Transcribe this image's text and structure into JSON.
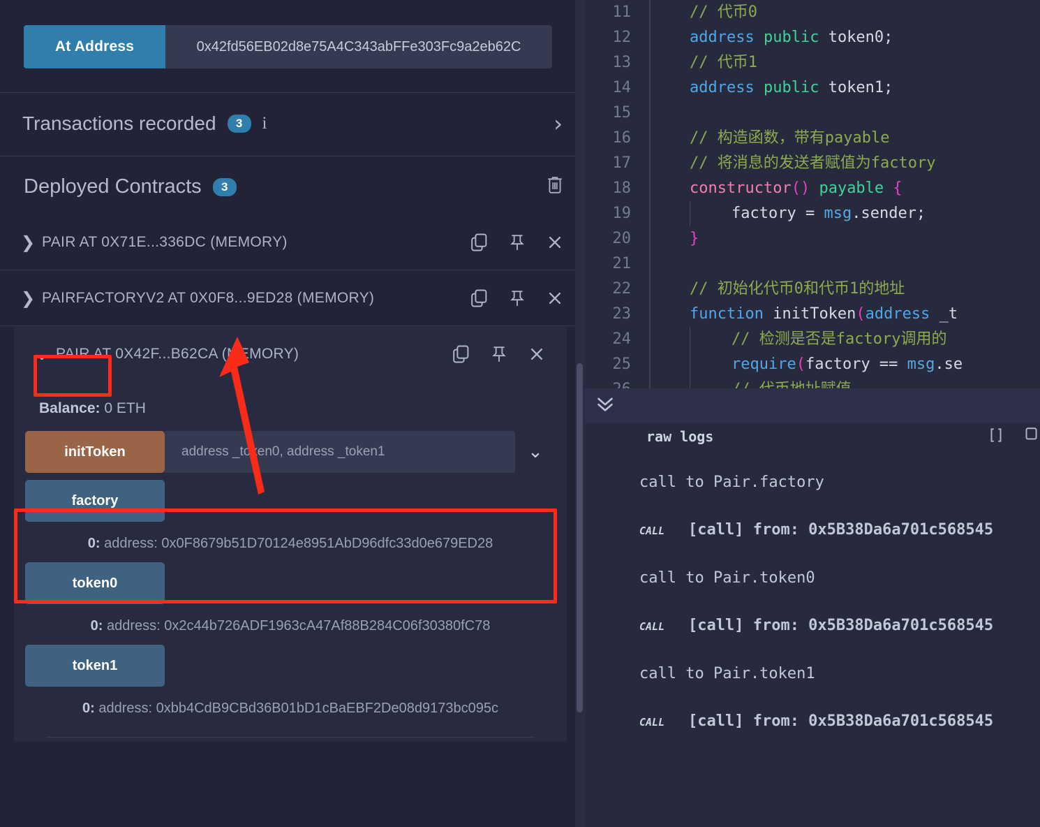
{
  "left_panel": {
    "at_address": {
      "button_label": "At Address",
      "input_value": "0x42fd56EB02d8e75A4C343abFFe303Fc9a2eb62C"
    },
    "transactions": {
      "title": "Transactions recorded",
      "count": "3",
      "info_glyph": "i",
      "chevron": "›"
    },
    "deployed": {
      "title": "Deployed Contracts",
      "count": "3",
      "trash_icon": "trash-icon"
    },
    "contracts": [
      {
        "label": "PAIR AT 0X71E...336DC (MEMORY)",
        "chevron": "❯",
        "expanded": false
      },
      {
        "label": "PAIRFACTORYV2 AT 0X0F8...9ED28 (MEMORY)",
        "chevron": "❯",
        "expanded": false
      },
      {
        "label": "PAIR AT 0X42F...B62CA (MEMORY)",
        "chevron": "⌄",
        "expanded": true
      }
    ],
    "expanded_card": {
      "balance_label": "Balance:",
      "balance_value": "0 ETH",
      "functions": [
        {
          "name": "initToken",
          "kind": "write",
          "input_placeholder": "address _token0, address _token1",
          "caret": "⌄",
          "result_index": "",
          "result_value": ""
        },
        {
          "name": "factory",
          "kind": "read",
          "result_index": "0:",
          "result_value": "address: 0x0F8679b51D70124e8951AbD96dfc33d0e679ED28"
        },
        {
          "name": "token0",
          "kind": "read",
          "result_index": "0:",
          "result_value": "address: 0x2c44b726ADF1963cA47Af88B284C06f30380fC78"
        },
        {
          "name": "token1",
          "kind": "read",
          "result_index": "0:",
          "result_value": "address: 0xbb4CdB9CBd36B01bD1cBaEBF2De08d9173bc095c"
        }
      ]
    }
  },
  "editor": {
    "lines": [
      {
        "n": "11",
        "indent": 1,
        "segments": [
          {
            "t": "// 代币0",
            "c": "tok-com"
          }
        ]
      },
      {
        "n": "12",
        "indent": 1,
        "segments": [
          {
            "t": "address",
            "c": "tok-kw"
          },
          {
            "t": " ",
            "c": "tok-id"
          },
          {
            "t": "public",
            "c": "tok-kw2"
          },
          {
            "t": " token0;",
            "c": "tok-id"
          }
        ]
      },
      {
        "n": "13",
        "indent": 1,
        "segments": [
          {
            "t": "// 代币1",
            "c": "tok-com"
          }
        ]
      },
      {
        "n": "14",
        "indent": 1,
        "segments": [
          {
            "t": "address",
            "c": "tok-kw"
          },
          {
            "t": " ",
            "c": "tok-id"
          },
          {
            "t": "public",
            "c": "tok-kw2"
          },
          {
            "t": " token1;",
            "c": "tok-id"
          }
        ]
      },
      {
        "n": "15",
        "indent": 1,
        "segments": []
      },
      {
        "n": "16",
        "indent": 1,
        "segments": [
          {
            "t": "// 构造函数，带有payable",
            "c": "tok-com"
          }
        ]
      },
      {
        "n": "17",
        "indent": 1,
        "segments": [
          {
            "t": "// 将消息的发送者赋值为factory",
            "c": "tok-com"
          }
        ]
      },
      {
        "n": "18",
        "indent": 1,
        "segments": [
          {
            "t": "constructor",
            "c": "tok-fn"
          },
          {
            "t": "()",
            "c": "tok-mag"
          },
          {
            "t": " ",
            "c": "tok-id"
          },
          {
            "t": "payable",
            "c": "tok-kw2"
          },
          {
            "t": " ",
            "c": "tok-id"
          },
          {
            "t": "{",
            "c": "tok-mag"
          }
        ]
      },
      {
        "n": "19",
        "indent": 2,
        "segments": [
          {
            "t": "factory",
            "c": "tok-id"
          },
          {
            "t": " = ",
            "c": "tok-id"
          },
          {
            "t": "msg",
            "c": "tok-blue2"
          },
          {
            "t": ".sender;",
            "c": "tok-id"
          }
        ]
      },
      {
        "n": "20",
        "indent": 1,
        "segments": [
          {
            "t": "}",
            "c": "tok-mag"
          }
        ]
      },
      {
        "n": "21",
        "indent": 1,
        "segments": []
      },
      {
        "n": "22",
        "indent": 1,
        "segments": [
          {
            "t": "// 初始化代币0和代币1的地址",
            "c": "tok-com"
          }
        ]
      },
      {
        "n": "23",
        "indent": 1,
        "segments": [
          {
            "t": "function",
            "c": "tok-kw"
          },
          {
            "t": " initToken",
            "c": "tok-id"
          },
          {
            "t": "(",
            "c": "tok-mag"
          },
          {
            "t": "address",
            "c": "tok-kw"
          },
          {
            "t": " _t",
            "c": "tok-id"
          }
        ]
      },
      {
        "n": "24",
        "indent": 2,
        "segments": [
          {
            "t": "// 检测是否是factory调用的",
            "c": "tok-com"
          }
        ]
      },
      {
        "n": "25",
        "indent": 2,
        "segments": [
          {
            "t": "require",
            "c": "tok-kw"
          },
          {
            "t": "(",
            "c": "tok-mag"
          },
          {
            "t": "factory == ",
            "c": "tok-id"
          },
          {
            "t": "msg",
            "c": "tok-blue2"
          },
          {
            "t": ".se",
            "c": "tok-id"
          }
        ]
      },
      {
        "n": "26",
        "indent": 2,
        "segments": [
          {
            "t": "// 代币地址赋值",
            "c": "tok-com"
          }
        ]
      }
    ],
    "collapse_chevron": "»"
  },
  "terminal": {
    "header_label": "raw logs",
    "header_icons": [
      "brackets-icon",
      "copy-icon"
    ],
    "entries": [
      {
        "type": "text",
        "text": "call to Pair.factory"
      },
      {
        "type": "call",
        "tag": "CALL",
        "text": "[call] from: 0x5B38Da6a701c568545"
      },
      {
        "type": "text",
        "text": "call to Pair.token0"
      },
      {
        "type": "call",
        "tag": "CALL",
        "text": "[call] from: 0x5B38Da6a701c568545"
      },
      {
        "type": "text",
        "text": "call to Pair.token1"
      },
      {
        "type": "call",
        "tag": "CALL",
        "text": "[call] from: 0x5B38Da6a701c568545"
      }
    ]
  },
  "annotations": {
    "highlight_color": "#ff2a1a",
    "boxes": [
      "pair-at-label-box",
      "factory-result-box"
    ],
    "arrow": "red-arrow-pointing-to-pairfactory-row"
  }
}
